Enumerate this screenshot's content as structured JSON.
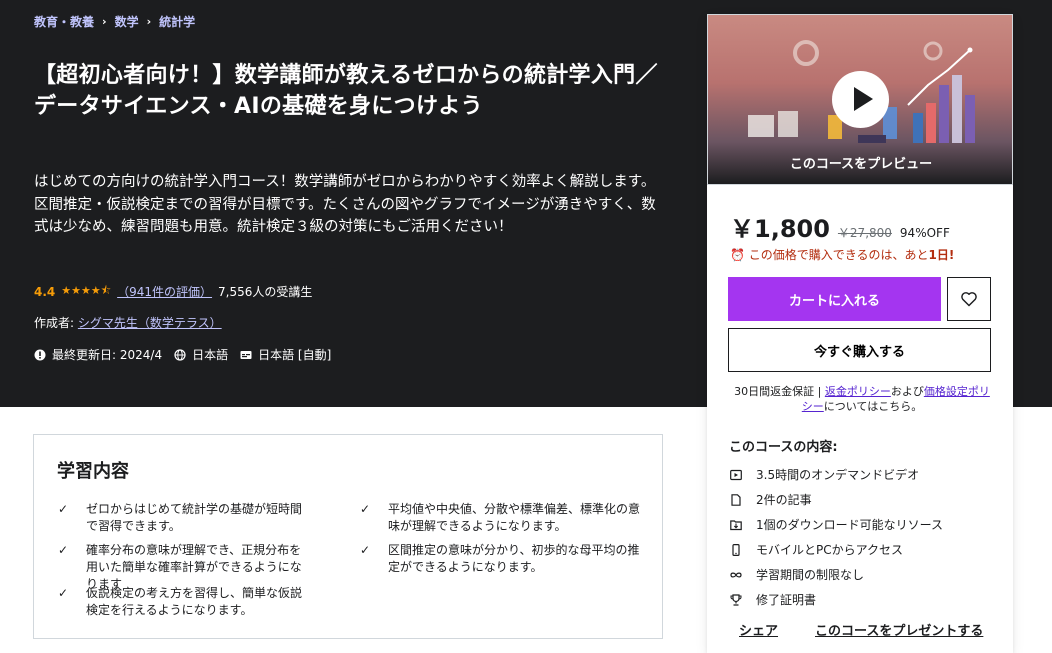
{
  "breadcrumb": [
    "教育・教養",
    "数学",
    "統計学"
  ],
  "course": {
    "title": "【超初心者向け！】数学講師が教えるゼロからの統計学入門／データサイエンス・AIの基礎を身につけよう",
    "subtitle": "はじめての方向けの統計学入門コース！数学講師がゼロからわかりやすく効率よく解説します。区間推定・仮説検定までの習得が目標です。たくさんの図やグラフでイメージが湧きやすく、数式は少なめ、練習問題も用意。統計検定３級の対策にもご活用ください！",
    "rating": "4.4",
    "rating_value": 4.4,
    "stars": "★★★★⯪",
    "review_count": "（941件の評価）",
    "students": "7,556人の受講生",
    "author_label": "作成者:",
    "author_name": "シグマ先生（数学テラス）",
    "updated": "最終更新日: 2024/4",
    "language": "日本語",
    "captions": "日本語 [自動]"
  },
  "learn": {
    "heading": "学習内容",
    "items": [
      "ゼロからはじめて統計学の基礎が短時間で習得できます。",
      "平均値や中央値、分散や標準偏差、標準化の意味が理解できるようになります。",
      "確率分布の意味が理解でき、正規分布を用いた簡単な確率計算ができるようになります",
      "区間推定の意味が分かり、初歩的な母平均の推定ができるようになります。",
      "仮説検定の考え方を習得し、簡単な仮説検定を行えるようになります。"
    ]
  },
  "card": {
    "preview_label": "このコースをプレビュー",
    "price": "￥1,800",
    "original_price": "￥27,800",
    "discount": "94%OFF",
    "timer_text": "この価格で購入できるのは、あと",
    "timer_days": "1日!",
    "cart_label": "カートに入れる",
    "buy_now_label": "今すぐ購入する",
    "guarantee_prefix": "30日間返金保証 | ",
    "refund_policy": "返金ポリシー",
    "and": "および",
    "pricing_policy": "価格設定ポリシー",
    "guarantee_suffix": "についてはこちら。",
    "includes_heading": "このコースの内容:",
    "includes": [
      {
        "icon": "video-icon",
        "text": "3.5時間のオンデマンドビデオ"
      },
      {
        "icon": "file-icon",
        "text": "2件の記事"
      },
      {
        "icon": "download-icon",
        "text": "1個のダウンロード可能なリソース"
      },
      {
        "icon": "mobile-icon",
        "text": "モバイルとPCからアクセス"
      },
      {
        "icon": "infinity-icon",
        "text": "学習期間の制限なし"
      },
      {
        "icon": "trophy-icon",
        "text": "修了証明書"
      }
    ],
    "share_label": "シェア",
    "gift_label": "このコースをプレゼントする"
  },
  "colors": {
    "hero_bg": "#1c1d1f",
    "accent": "#a435f0",
    "link": "#c0c4fc",
    "star": "#f69c08",
    "timer": "#b32d0f"
  }
}
